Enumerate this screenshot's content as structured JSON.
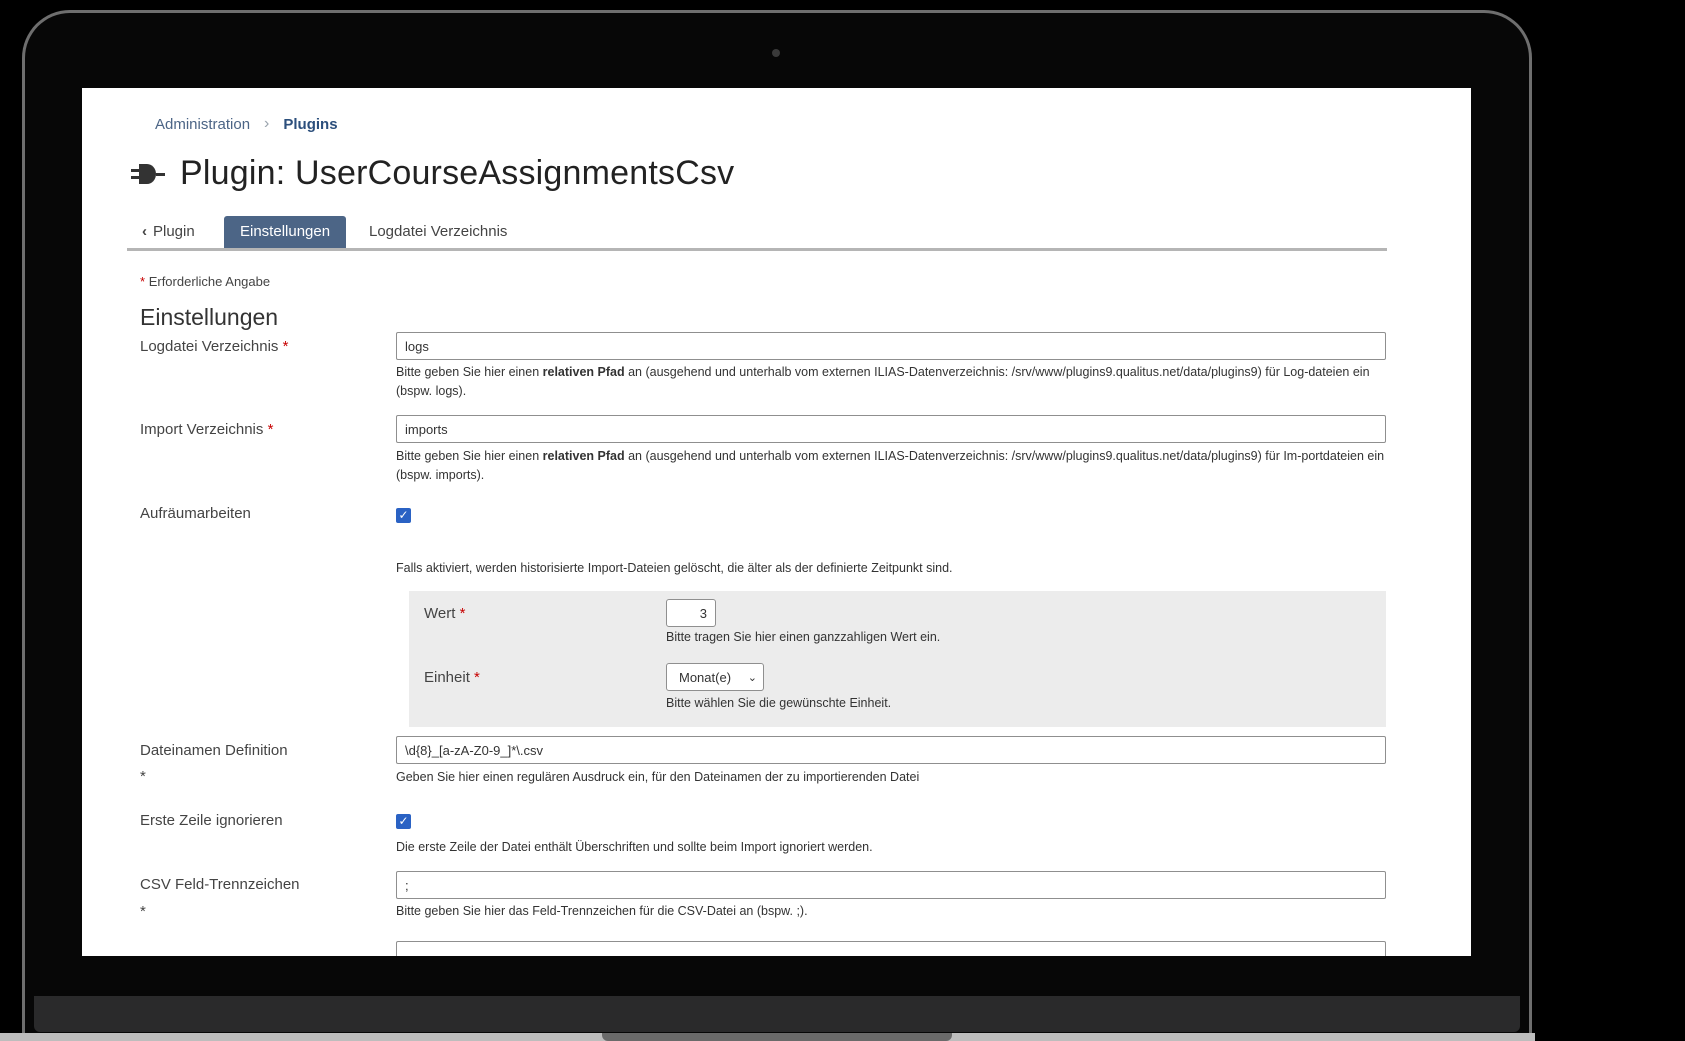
{
  "breadcrumb": {
    "item1": "Administration",
    "item2": "Plugins"
  },
  "page_title": "Plugin: UserCourseAssignmentsCsv",
  "tabs": {
    "back": "Plugin",
    "active": "Einstellungen",
    "third": "Logdatei Verzeichnis"
  },
  "required_note": "Erforderliche Angabe",
  "section_title": "Einstellungen",
  "fields": {
    "logdir": {
      "label": "Logdatei Verzeichnis",
      "value": "logs",
      "help_pre": "Bitte geben Sie hier einen ",
      "help_bold": "relativen Pfad",
      "help_post": " an (ausgehend und unterhalb vom externen ILIAS-Datenverzeichnis: /srv/www/plugins9.qualitus.net/data/plugins9) für Log-dateien ein (bspw. logs)."
    },
    "importdir": {
      "label": "Import Verzeichnis",
      "value": "imports",
      "help_pre": "Bitte geben Sie hier einen ",
      "help_bold": "relativen Pfad",
      "help_post": " an (ausgehend und unterhalb vom externen ILIAS-Datenverzeichnis: /srv/www/plugins9.qualitus.net/data/plugins9) für Im-portdateien ein (bspw. imports)."
    },
    "cleanup": {
      "label": "Aufräumarbeiten",
      "checked": true,
      "help": "Falls aktiviert, werden historisierte Import-Dateien gelöscht, die älter als der definierte Zeitpunkt sind.",
      "wert": {
        "label": "Wert",
        "value": "3",
        "help": "Bitte tragen Sie hier einen ganzzahligen Wert ein."
      },
      "einheit": {
        "label": "Einheit",
        "value": "Monat(e)",
        "help": "Bitte wählen Sie die gewünschte Einheit."
      }
    },
    "filename": {
      "label": "Dateinamen Definition",
      "value": "\\d{8}_[a-zA-Z0-9_]*\\.csv",
      "help": "Geben Sie hier einen regulären Ausdruck ein, für den Dateinamen der zu importierenden Datei"
    },
    "firstrow": {
      "label": "Erste Zeile ignorieren",
      "checked": true,
      "help": "Die erste Zeile der Datei enthält Überschriften und sollte beim Import ignoriert werden."
    },
    "separator": {
      "label": "CSV Feld-Trennzeichen",
      "value": ";",
      "help": "Bitte geben Sie hier das Feld-Trennzeichen für die CSV-Datei an (bspw. ;)."
    }
  },
  "required_star": "*",
  "checkmark": "✓",
  "icons": {
    "plug": "plug-icon",
    "back": "chevron-left-icon",
    "breadcrumb_sep": "chevron-right-icon",
    "select": "chevron-down-icon"
  },
  "colors": {
    "accent": "#4c6586",
    "required": "#c70000",
    "checkbox": "#2a62c4"
  }
}
